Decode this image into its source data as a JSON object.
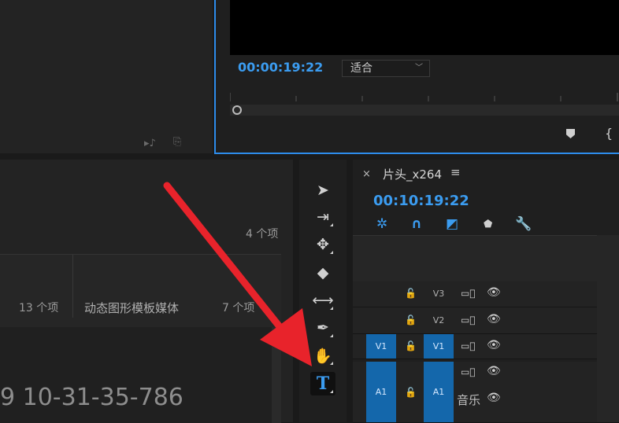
{
  "program_monitor": {
    "timecode": "00:00:19:22",
    "fit_select_value": "适合"
  },
  "project_panel": {
    "items_count_top": "4 个项",
    "bin_items_13": "13 个项",
    "bin_motion_media": "动态图形模板媒体",
    "bin_items_7": "7 个项",
    "watermark_number": "9 10-31-35-786"
  },
  "tools": [
    {
      "name": "selection-tool-icon",
      "glyph": "➤"
    },
    {
      "name": "track-select-tool-icon",
      "glyph": "⇥"
    },
    {
      "name": "ripple-edit-tool-icon",
      "glyph": "✥"
    },
    {
      "name": "razor-tool-icon",
      "glyph": "◆"
    },
    {
      "name": "slip-tool-icon",
      "glyph": "⟷"
    },
    {
      "name": "pen-tool-icon",
      "glyph": "✒"
    },
    {
      "name": "hand-tool-icon",
      "glyph": "✋"
    },
    {
      "name": "type-tool-icon",
      "glyph": "T"
    }
  ],
  "timeline": {
    "close_glyph": "×",
    "sequence_title": "片头_x264",
    "menu_glyph": "≡",
    "timecode": "00:10:19:22",
    "tracks": [
      {
        "label": "V3",
        "source": ""
      },
      {
        "label": "V2",
        "source": ""
      },
      {
        "label": "V1",
        "source": "V1"
      },
      {
        "label": "A1",
        "source": "A1"
      }
    ],
    "audio_clip_label": "音乐"
  },
  "colors": {
    "accent_blue": "#3b9cf0",
    "track_target_blue": "#1467ab",
    "arrow_red": "#e8232b"
  }
}
